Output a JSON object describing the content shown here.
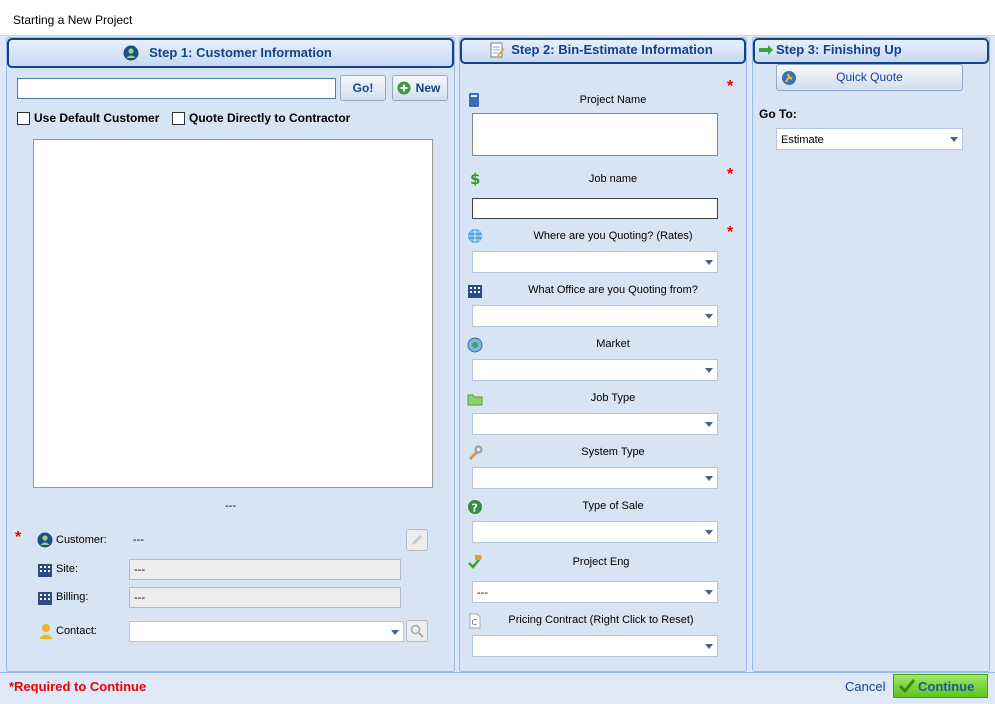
{
  "window": {
    "title": "Starting a New Project"
  },
  "step1": {
    "title": "Step 1: Customer Information",
    "search_value": "",
    "go_label": "Go!",
    "new_label": "New",
    "use_default_label": "Use Default Customer",
    "quote_direct_label": "Quote Directly to Contractor",
    "results_caption": "---",
    "customer_label": "Customer:",
    "customer_value": "---",
    "site_label": "Site:",
    "site_value": "---",
    "billing_label": "Billing:",
    "billing_value": "---",
    "contact_label": "Contact:",
    "contact_value": ""
  },
  "step2": {
    "title": "Step 2: Bin-Estimate Information",
    "project_name_label": "Project Name",
    "job_name_label": "Job name",
    "where_label": "Where are you Quoting? (Rates)",
    "office_label": "What Office are you Quoting from?",
    "market_label": "Market",
    "job_type_label": "Job Type",
    "system_type_label": "System Type",
    "type_of_sale_label": "Type of Sale",
    "project_eng_label": "Project Eng",
    "project_eng_value": "---",
    "pricing_contract_label": "Pricing Contract (Right Click to Reset)"
  },
  "step3": {
    "title": "Step 3: Finishing Up",
    "quick_quote_label": "Quick Quote",
    "goto_label": "Go To:",
    "goto_value": "Estimate"
  },
  "footer": {
    "required_text": "*Required to Continue",
    "cancel_label": "Cancel",
    "continue_label": "Continue"
  },
  "required_mark": "*"
}
